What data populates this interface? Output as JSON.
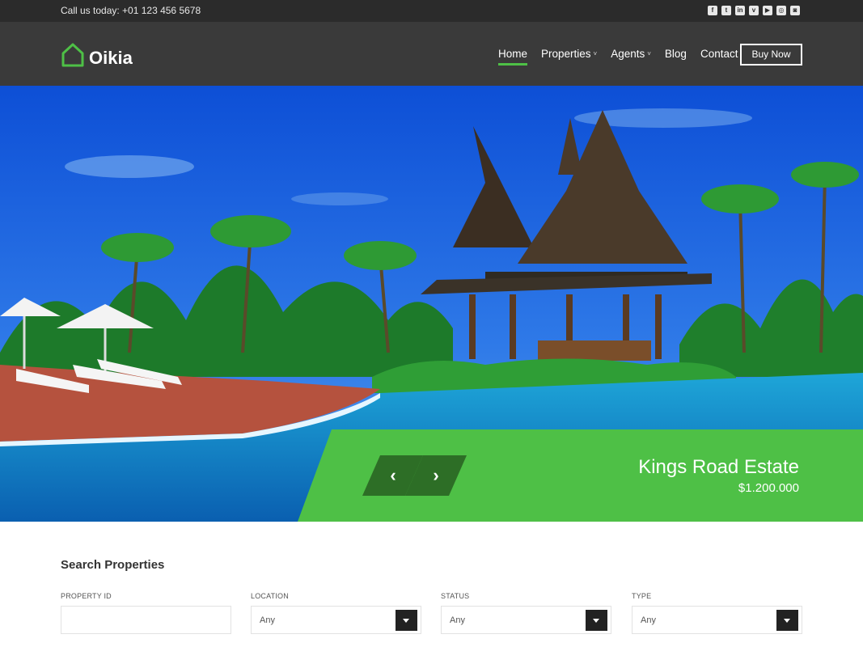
{
  "topbar": {
    "phone": "Call us today: +01 123 456 5678",
    "social_icons": [
      "facebook-icon",
      "twitter-icon",
      "linkedin-icon",
      "vimeo-icon",
      "youtube-icon",
      "dribbble-icon",
      "instagram-icon"
    ]
  },
  "header": {
    "logo_text": "Oikia",
    "nav": [
      {
        "label": "Home",
        "active": true
      },
      {
        "label": "Properties",
        "dropdown": true
      },
      {
        "label": "Agents",
        "dropdown": true
      },
      {
        "label": "Blog"
      },
      {
        "label": "Contact"
      }
    ],
    "buy_label": "Buy Now"
  },
  "hero": {
    "title": "Kings Road Estate",
    "price": "$1.200.000"
  },
  "search": {
    "title": "Search Properties",
    "fields": [
      {
        "label": "PROPERTY ID",
        "value": ""
      },
      {
        "label": "LOCATION",
        "value": "Any"
      },
      {
        "label": "STATUS",
        "value": "Any"
      },
      {
        "label": "TYPE",
        "value": "Any"
      }
    ]
  },
  "colors": {
    "accent": "#4ec046",
    "header_bg": "#3a3a3a",
    "topbar_bg": "#2b2b2b"
  }
}
